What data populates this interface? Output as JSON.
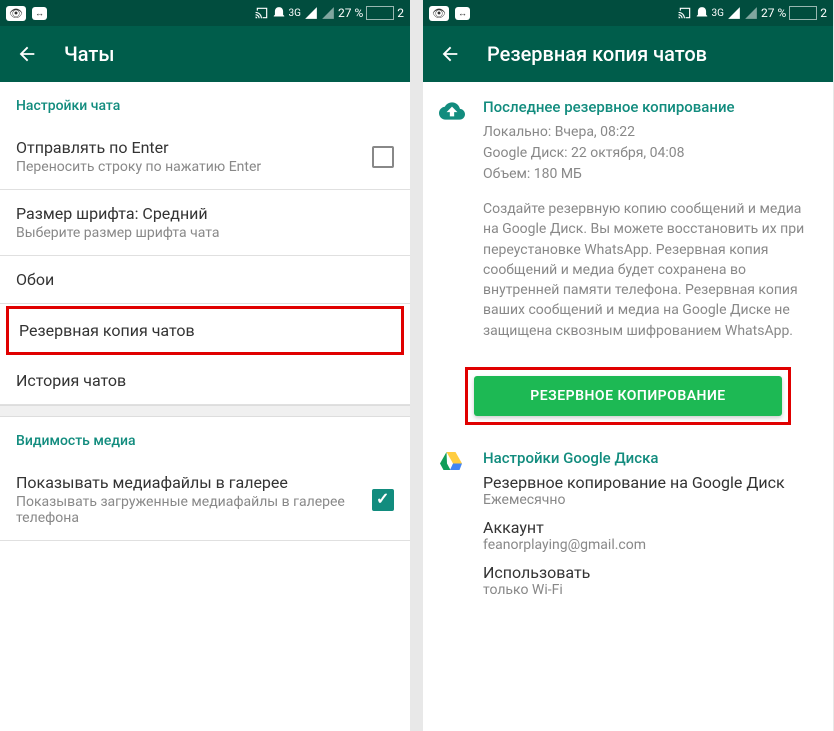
{
  "statusbar": {
    "battery_pct": "27 %",
    "time": "2",
    "network": "3G"
  },
  "left": {
    "title": "Чаты",
    "section1": "Настройки чата",
    "enter": {
      "title": "Отправлять по Enter",
      "sub": "Переносить строку по нажатию Enter"
    },
    "font": {
      "title": "Размер шрифта: Средний",
      "sub": "Выберите размер шрифта чата"
    },
    "wallpaper": "Обои",
    "backup": "Резервная копия чатов",
    "history": "История чатов",
    "section2": "Видимость медиа",
    "media": {
      "title": "Показывать медиафайлы в галерее",
      "sub": "Показывать загруженные медиафайлы в галерее телефона"
    }
  },
  "right": {
    "title": "Резервная копия чатов",
    "last_backup": "Последнее резервное копирование",
    "meta1": "Локально: Вчера, 08:22",
    "meta2": "Google Диск: 22 октября, 04:08",
    "meta3": "Объем: 180 МБ",
    "desc": "Создайте резервную копию сообщений и медиа на Google Диск. Вы можете восстановить их при переустановке WhatsApp. Резервная копия сообщений и медиа будет сохранена во внутренней памяти телефона. Резервная копия ваших сообщений и медиа на Google Диске не защищена сквозным шифрованием WhatsApp.",
    "button": "РЕЗЕРВНОЕ КОПИРОВАНИЕ",
    "gdrive_header": "Настройки Google Диска",
    "gdrive_backup": {
      "title": "Резервное копирование на Google Диск",
      "value": "Ежемесячно"
    },
    "account": {
      "title": "Аккаунт",
      "value": "feanorplaying@gmail.com"
    },
    "use": {
      "title": "Использовать",
      "value": "только Wi-Fi"
    }
  }
}
